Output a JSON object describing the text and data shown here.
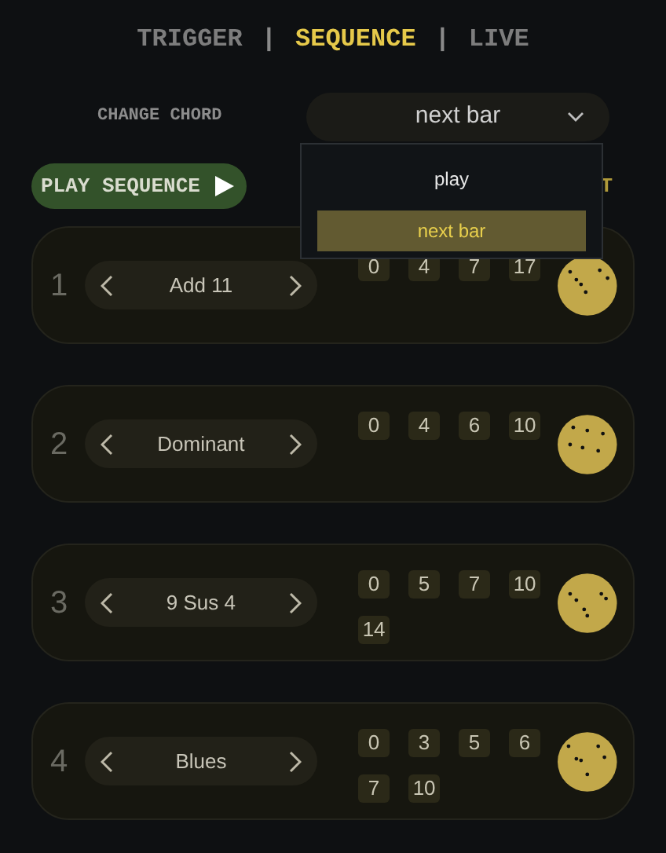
{
  "tabs": [
    {
      "label": "TRIGGER",
      "selected": false
    },
    {
      "label": "SEQUENCE",
      "selected": true
    },
    {
      "label": "LIVE",
      "selected": false
    }
  ],
  "separator": "|",
  "change_chord": {
    "label": "CHANGE CHORD",
    "value": "next bar",
    "expanded": true,
    "options": [
      {
        "label": "play",
        "selected": false
      },
      {
        "label": "next bar",
        "selected": true
      }
    ]
  },
  "play_button": {
    "label": "PLAY SEQUENCE"
  },
  "hidden_label": "T",
  "chords": [
    {
      "index": "1",
      "name": "Add 11",
      "intervals": [
        "0",
        "4",
        "7",
        "17"
      ]
    },
    {
      "index": "2",
      "name": "Dominant",
      "intervals": [
        "0",
        "4",
        "6",
        "10"
      ]
    },
    {
      "index": "3",
      "name": "9 Sus 4",
      "intervals": [
        "0",
        "5",
        "7",
        "10",
        "14"
      ]
    },
    {
      "index": "4",
      "name": "Blues",
      "intervals": [
        "0",
        "3",
        "5",
        "6",
        "7",
        "10"
      ]
    }
  ]
}
